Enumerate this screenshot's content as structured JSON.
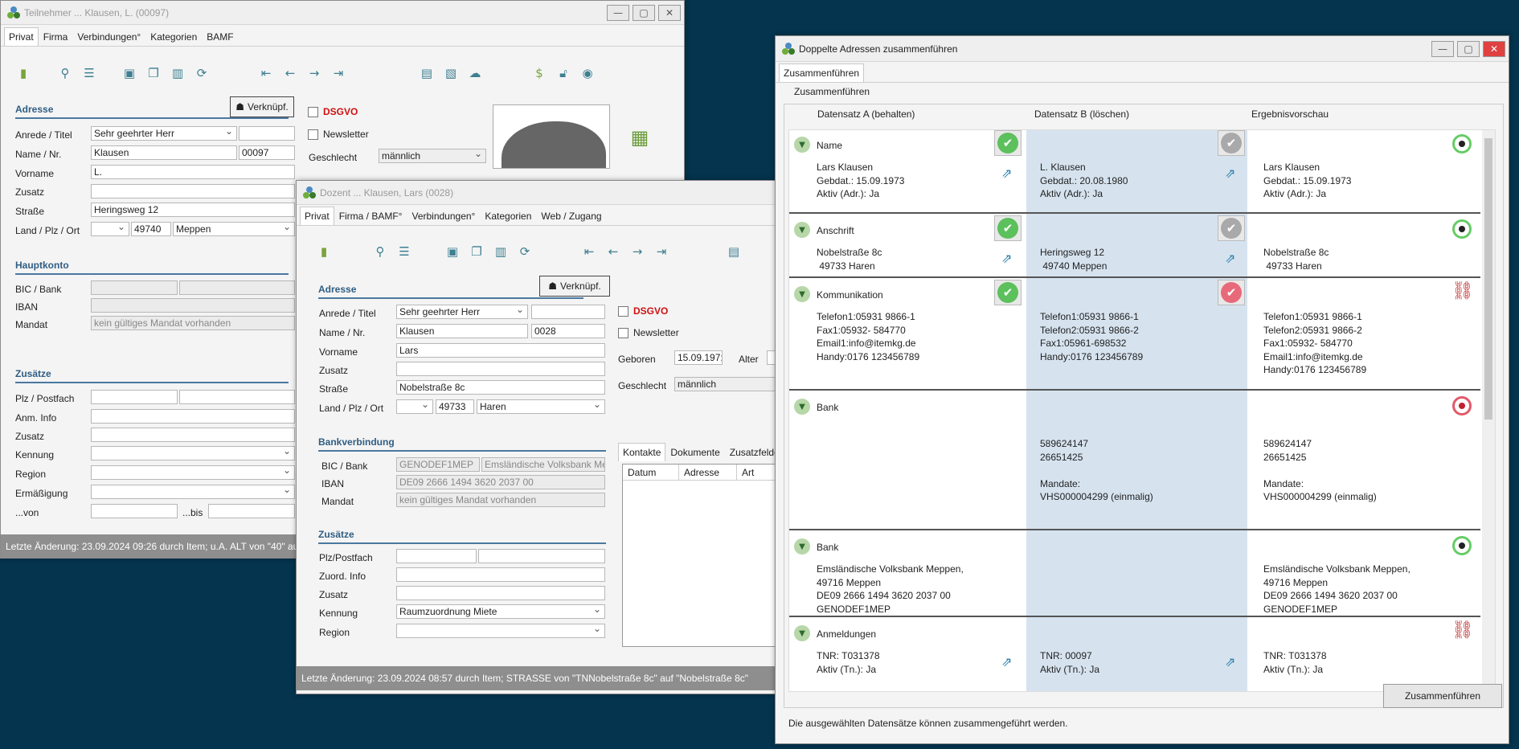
{
  "win1": {
    "title": "Teilnehmer ... Klausen, L. (00097)",
    "tabs": [
      "Privat",
      "Firma",
      "Verbindungen°",
      "Kategorien",
      "BAMF"
    ],
    "section_adresse": "Adresse",
    "verknuepf": "Verknüpf.",
    "labels": {
      "anrede": "Anrede / Titel",
      "name": "Name / Nr.",
      "vorname": "Vorname",
      "zusatz": "Zusatz",
      "strasse": "Straße",
      "land": "Land / Plz / Ort"
    },
    "values": {
      "anrede": "Sehr geehrter Herr",
      "name": "Klausen",
      "nr": "00097",
      "vorname": "L.",
      "strasse": "Heringsweg 12",
      "plz": "49740",
      "ort": "Meppen"
    },
    "dsgvo": "DSGVO",
    "newsletter": "Newsletter",
    "geschlecht_label": "Geschlecht",
    "geschlecht": "männlich",
    "section_konto": "Hauptkonto",
    "bic": "BIC / Bank",
    "iban": "IBAN",
    "mandat": "Mandat",
    "mandat_val": "kein gültiges Mandat vorhanden",
    "section_zusaetze": "Zusätze",
    "z_labels": [
      "Plz / Postfach",
      "Anm. Info",
      "Zusatz",
      "Kennung",
      "Region",
      "Ermäßigung",
      "...von"
    ],
    "bis": "...bis",
    "status": "Letzte Änderung: 23.09.2024 09:26 durch Item; u.A. ALT von \"40\" auf"
  },
  "win2": {
    "title": "Dozent ... Klausen, Lars (0028)",
    "tabs": [
      "Privat",
      "Firma / BAMF°",
      "Verbindungen°",
      "Kategorien",
      "Web / Zugang"
    ],
    "section_adresse": "Adresse",
    "verknuepf": "Verknüpf.",
    "labels": {
      "anrede": "Anrede / Titel",
      "name": "Name / Nr.",
      "vorname": "Vorname",
      "zusatz": "Zusatz",
      "strasse": "Straße",
      "land": "Land / Plz / Ort"
    },
    "values": {
      "anrede": "Sehr geehrter Herr",
      "name": "Klausen",
      "nr": "0028",
      "vorname": "Lars",
      "strasse": "Nobelstraße 8c",
      "plz": "49733",
      "ort": "Haren"
    },
    "dsgvo": "DSGVO",
    "newsletter": "Newsletter",
    "geboren_label": "Geboren",
    "geboren": "15.09.197:",
    "alter": "Alter",
    "geschlecht_label": "Geschlecht",
    "geschlecht": "männlich",
    "section_bank": "Bankverbindung",
    "bic": "BIC / Bank",
    "bic_val": "GENODEF1MEP",
    "bank_val": "Emsländische Volksbank Me",
    "iban": "IBAN",
    "iban_val": "DE09 2666 1494 3620 2037 00",
    "mandat": "Mandat",
    "mandat_val": "kein gültiges Mandat vorhanden",
    "section_zusaetze": "Zusätze",
    "z_labels": [
      "Plz/Postfach",
      "Zuord. Info",
      "Zusatz",
      "Kennung",
      "Region"
    ],
    "kennung_val": "Raumzuordnung Miete",
    "subtabs": [
      "Kontakte",
      "Dokumente",
      "Zusatzfelder"
    ],
    "cols": [
      "Datum",
      "Adresse",
      "Art"
    ],
    "status": "Letzte Änderung: 23.09.2024 08:57 durch Item; STRASSE von \"TNNobelstraße 8c\" auf \"Nobelstraße 8c\""
  },
  "merge": {
    "title": "Doppelte Adressen zusammenführen",
    "tab": "Zusammenführen",
    "group": "Zusammenführen",
    "headers": [
      "Datensatz A (behalten)",
      "Datensatz B (löschen)",
      "Ergebnisvorschau"
    ],
    "rows": [
      {
        "name": "Name",
        "a": "Lars Klausen\nGebdat.: 15.09.1973\nAktiv (Adr.): Ja",
        "b": "L. Klausen\nGebdat.: 20.08.1980\nAktiv (Adr.): Ja",
        "r": "Lars Klausen\nGebdat.: 15.09.1973\nAktiv (Adr.): Ja"
      },
      {
        "name": "Anschrift",
        "a": "Nobelstraße 8c\n 49733 Haren",
        "b": "Heringsweg 12\n 49740 Meppen",
        "r": "Nobelstraße 8c\n 49733 Haren"
      },
      {
        "name": "Kommunikation",
        "a": "Telefon1:05931 9866-1\nFax1:05932- 584770\nEmail1:info@itemkg.de\nHandy:0176 123456789",
        "b": "Telefon1:05931 9866-1\nTelefon2:05931 9866-2\nFax1:05961-698532\nHandy:0176 123456789",
        "r": "Telefon1:05931 9866-1\nTelefon2:05931 9866-2\nFax1:05932- 584770\nEmail1:info@itemkg.de\nHandy:0176 123456789"
      },
      {
        "name": "Bank",
        "a": "",
        "b": "589624147\n26651425\n\nMandate:\nVHS000004299 (einmalig)",
        "r": "589624147\n26651425\n\nMandate:\nVHS000004299 (einmalig)"
      },
      {
        "name": "Bank",
        "a": "Emsländische Volksbank Meppen,\n49716 Meppen\nDE09 2666 1494 3620 2037 00\nGENODEF1MEP",
        "b": "",
        "r": "Emsländische Volksbank Meppen,\n49716 Meppen\nDE09 2666 1494 3620 2037 00\nGENODEF1MEP"
      },
      {
        "name": "Anmeldungen",
        "a": "TNR: T031378\nAktiv (Tn.): Ja",
        "b": "TNR: 00097\nAktiv (Tn.): Ja",
        "r": "TNR: T031378\nAktiv (Tn.): Ja"
      }
    ],
    "button": "Zusammenführen",
    "status": "Die ausgewählten Datensätze können zusammengeführt werden."
  }
}
